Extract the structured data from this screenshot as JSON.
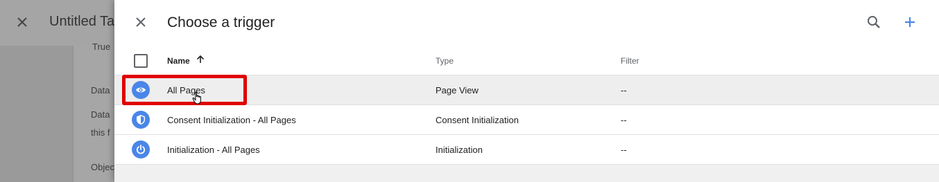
{
  "background_editor": {
    "title": "Untitled Ta",
    "fragments": [
      "True",
      "Data",
      "Data",
      "this f",
      "Objec"
    ]
  },
  "panel": {
    "title": "Choose a trigger",
    "icons": {
      "close": "close-icon",
      "search": "search-icon",
      "add": "plus-icon"
    },
    "accent_color": "#4a86e8"
  },
  "table": {
    "headers": {
      "name": "Name",
      "type": "Type",
      "filter": "Filter"
    },
    "sort": "name-ascending",
    "rows": [
      {
        "name": "All Pages",
        "type": "Page View",
        "filter": "--",
        "icon": "eye-icon",
        "highlighted": true
      },
      {
        "name": "Consent Initialization - All Pages",
        "type": "Consent Initialization",
        "filter": "--",
        "icon": "shield-icon"
      },
      {
        "name": "Initialization - All Pages",
        "type": "Initialization",
        "filter": "--",
        "icon": "power-icon"
      }
    ]
  },
  "annotation": {
    "highlight_color": "#e00000"
  }
}
